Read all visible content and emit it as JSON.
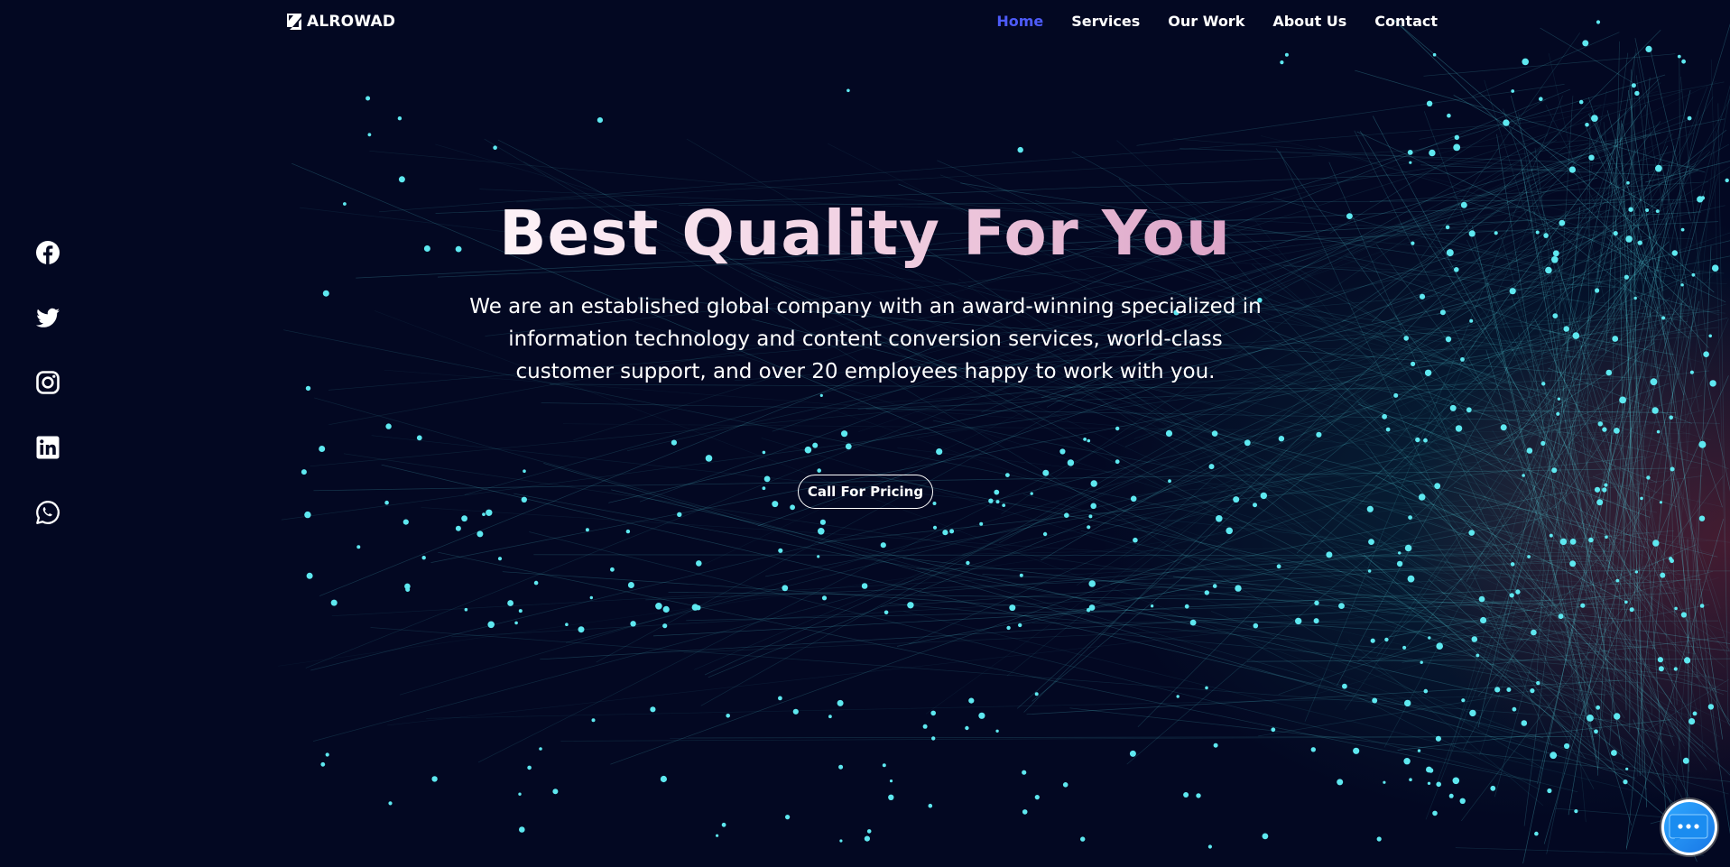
{
  "brand": {
    "logo_icon": "alrowad-logo-mark",
    "name": "ALROWAD"
  },
  "nav": {
    "items": [
      {
        "label": "Home",
        "active": true
      },
      {
        "label": "Services",
        "active": false
      },
      {
        "label": "Our Work",
        "active": false
      },
      {
        "label": "About Us",
        "active": false
      },
      {
        "label": "Contact",
        "active": false
      }
    ]
  },
  "social": [
    {
      "icon": "facebook-icon"
    },
    {
      "icon": "twitter-icon"
    },
    {
      "icon": "instagram-icon"
    },
    {
      "icon": "linkedin-icon"
    },
    {
      "icon": "whatsapp-icon"
    }
  ],
  "hero": {
    "title": "Best Quality For You",
    "description": "We are an established global company with an award-winning specialized in information technology and content conversion services, world-class customer support, and over 20 employees happy to work with you.",
    "cta_label": "Call For Pricing"
  },
  "chat_widget": {
    "icon": "chat-bubble-icon"
  },
  "colors": {
    "background": "#030822",
    "nav_active": "#4d5bf9",
    "particle": "#5ee8f0",
    "title_gradient_start": "#fdf2f7",
    "title_gradient_end": "#dca4c7"
  }
}
